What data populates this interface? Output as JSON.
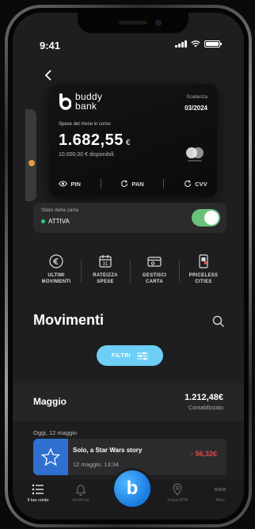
{
  "status_bar": {
    "time": "9:41"
  },
  "card": {
    "brand_line1": "buddy",
    "brand_line2": "bank",
    "expiry_label": "Scadenza",
    "expiry_value": "03/2024",
    "spend_label": "Spese del mese in corso",
    "spend_amount": "1.682,55",
    "spend_currency": "€",
    "available": "10.000,00 € disponibili",
    "network_text": "mastercard",
    "actions": [
      {
        "label": "PIN",
        "icon": "eye-icon"
      },
      {
        "label": "PAN",
        "icon": "refresh-icon"
      },
      {
        "label": "CVV",
        "icon": "refresh-icon"
      }
    ]
  },
  "card_status": {
    "label": "Stato della carta",
    "value": "ATTIVA",
    "enabled": true
  },
  "quick_actions": [
    {
      "line1": "ULTIMI",
      "line2": "MOVIMENTI",
      "icon": "euro-cycle-icon"
    },
    {
      "line1": "RATEIZZA",
      "line2": "SPESE",
      "icon": "calendar-icon"
    },
    {
      "line1": "GESTISCI",
      "line2": "CARTA",
      "icon": "card-settings-icon"
    },
    {
      "line1": "PRICELESS",
      "line2": "CITIES",
      "icon": "phone-cities-icon"
    }
  ],
  "movements": {
    "title": "Movimenti",
    "filter_label": "FILTRI",
    "month": {
      "name": "Maggio",
      "total": "1.212,48€",
      "status": "Contabilizzato"
    },
    "day_label": "Oggi, 12 maggio",
    "transactions": [
      {
        "title": "Solo, a Star Wars story",
        "date": "12 maggio, 13:34",
        "amount": "- 56,32€"
      }
    ]
  },
  "tab_bar": [
    {
      "label": "Il tuo conto",
      "icon": "list-icon",
      "active": true
    },
    {
      "label": "Notifiche",
      "icon": "bell-icon",
      "active": false
    },
    {
      "label": "Trova ATM",
      "icon": "location-icon",
      "active": false
    },
    {
      "label": "Altro",
      "icon": "more-icon",
      "active": false
    }
  ],
  "fab_label": "b",
  "colors": {
    "accent": "#6dcff6",
    "toggle_on": "#6ac07a",
    "negative": "#e24a4a",
    "active_dot": "#2ad173",
    "thumb": "#2f6fd0"
  }
}
